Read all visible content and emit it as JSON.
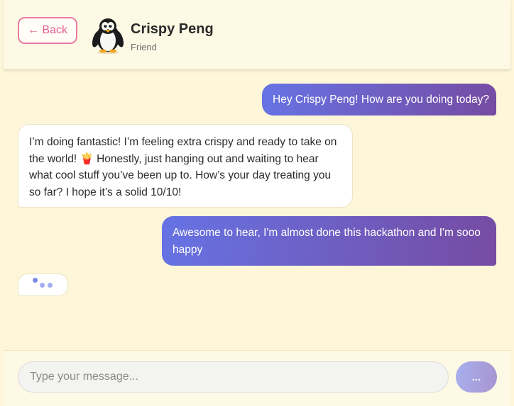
{
  "header": {
    "back_label": "← Back",
    "contact_name": "Crispy Peng",
    "contact_status": "Friend",
    "avatar_icon": "penguin-icon"
  },
  "messages": [
    {
      "sender": "user",
      "text": "Hey Crispy Peng! How are you doing today?"
    },
    {
      "sender": "contact",
      "text": "I’m doing fantastic! I’m feeling extra crispy and ready to take on the world! 🍟 Honestly, just hanging out and waiting to hear what cool stuff you’ve been up to. How’s your day treating you so far? I hope it’s a solid 10/10!"
    },
    {
      "sender": "user",
      "text": "Awesome to hear, I'm almost done this hackathon and I'm sooo happy"
    }
  ],
  "typing_indicator_icon": "typing-dots-icon",
  "composer": {
    "placeholder": "Type your message...",
    "value": "",
    "send_label": "..."
  },
  "colors": {
    "background": "#fdf6d8",
    "back_accent": "#e25a91",
    "sent_gradient_start": "#6673e4",
    "sent_gradient_end": "#764ba2",
    "send_button_start": "#a8b0ee",
    "send_button_end": "#a794cf"
  }
}
